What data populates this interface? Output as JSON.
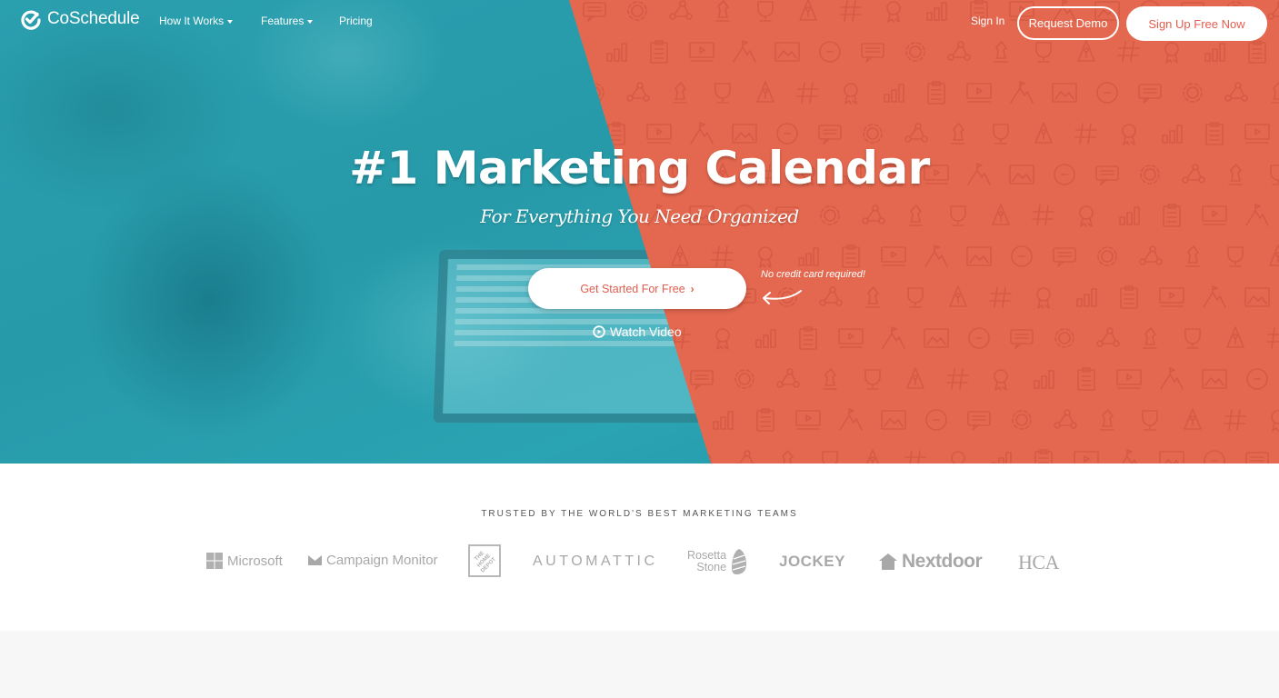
{
  "colors": {
    "teal": "#2a9fae",
    "coral": "#e4684f",
    "cta_text": "#e05e4f",
    "logo_gray": "#a8a8a8"
  },
  "nav": {
    "brand": "CoSchedule",
    "links": [
      {
        "label": "How It Works",
        "has_dropdown": true
      },
      {
        "label": "Features",
        "has_dropdown": true
      },
      {
        "label": "Pricing",
        "has_dropdown": false
      }
    ],
    "sign_in": "Sign In",
    "request_demo": "Request Demo",
    "sign_up": "Sign Up Free Now"
  },
  "hero": {
    "headline": "#1 Marketing Calendar",
    "subheadline": "For Everything You Need Organized",
    "cta_label": "Get Started For Free",
    "cta_icon": "chevron-right-icon",
    "note": "No credit card required!",
    "watch_video": "Watch Video",
    "watch_icon": "play-circle-icon"
  },
  "trusted": {
    "title": "TRUSTED BY THE WORLD'S BEST MARKETING TEAMS",
    "logos": [
      "Microsoft",
      "Campaign Monitor",
      "The Home Depot",
      "AUTOMATTIC",
      "Rosetta Stone",
      "JOCKEY",
      "Nextdoor",
      "HCA"
    ],
    "rosetta_line1": "Rosetta",
    "rosetta_line2": "Stone",
    "home_depot_text": "THE HOME DEPOT"
  }
}
